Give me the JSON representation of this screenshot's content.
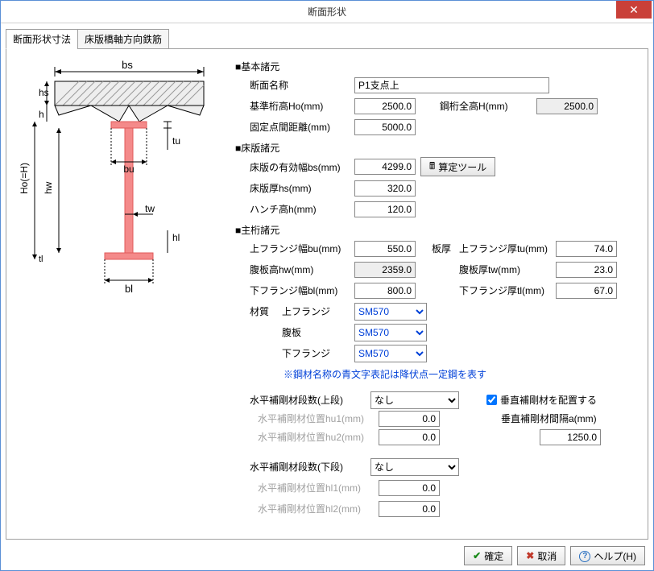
{
  "window": {
    "title": "断面形状"
  },
  "tabs": {
    "tab1": "断面形状寸法",
    "tab2": "床版橋軸方向鉄筋"
  },
  "basic": {
    "header": "■基本諸元",
    "name_lbl": "断面名称",
    "name_val": "P1支点上",
    "Ho_lbl": "基準桁高Ho(mm)",
    "Ho_val": "2500.0",
    "H_lbl": "鋼桁全高H(mm)",
    "H_val": "2500.0",
    "fixdist_lbl": "固定点間距離(mm)",
    "fixdist_val": "5000.0"
  },
  "slab": {
    "header": "■床版諸元",
    "bs_lbl": "床版の有効幅bs(mm)",
    "bs_val": "4299.0",
    "calc_btn": "算定ツール",
    "hs_lbl": "床版厚hs(mm)",
    "hs_val": "320.0",
    "h_lbl": "ハンチ高h(mm)",
    "h_val": "120.0"
  },
  "girder": {
    "header": "■主桁諸元",
    "bu_lbl": "上フランジ幅bu(mm)",
    "bu_val": "550.0",
    "thick_lbl": "板厚",
    "tu_lbl": "上フランジ厚tu(mm)",
    "tu_val": "74.0",
    "hw_lbl": "腹板高hw(mm)",
    "hw_val": "2359.0",
    "tw_lbl": "腹板厚tw(mm)",
    "tw_val": "23.0",
    "bl_lbl": "下フランジ幅bl(mm)",
    "bl_val": "800.0",
    "tl_lbl": "下フランジ厚tl(mm)",
    "tl_val": "67.0",
    "mat_lbl": "材質",
    "mat_uf_lbl": "上フランジ",
    "mat_web_lbl": "腹板",
    "mat_lf_lbl": "下フランジ",
    "mat_sel": "SM570",
    "mat_note": "※鋼材名称の青文字表記は降伏点一定鋼を表す"
  },
  "stiff": {
    "upper_lbl": "水平補剛材段数(上段)",
    "lower_lbl": "水平補剛材段数(下段)",
    "none": "なし",
    "hu1_lbl": "水平補剛材位置hu1(mm)",
    "hu2_lbl": "水平補剛材位置hu2(mm)",
    "hl1_lbl": "水平補剛材位置hl1(mm)",
    "hl2_lbl": "水平補剛材位置hl2(mm)",
    "zero": "0.0",
    "vert_chk_lbl": "垂直補剛材を配置する",
    "vert_a_lbl": "垂直補剛材間隔a(mm)",
    "vert_a_val": "1250.0"
  },
  "footer": {
    "ok": "確定",
    "cancel": "取消",
    "help": "ヘルプ(H)"
  }
}
